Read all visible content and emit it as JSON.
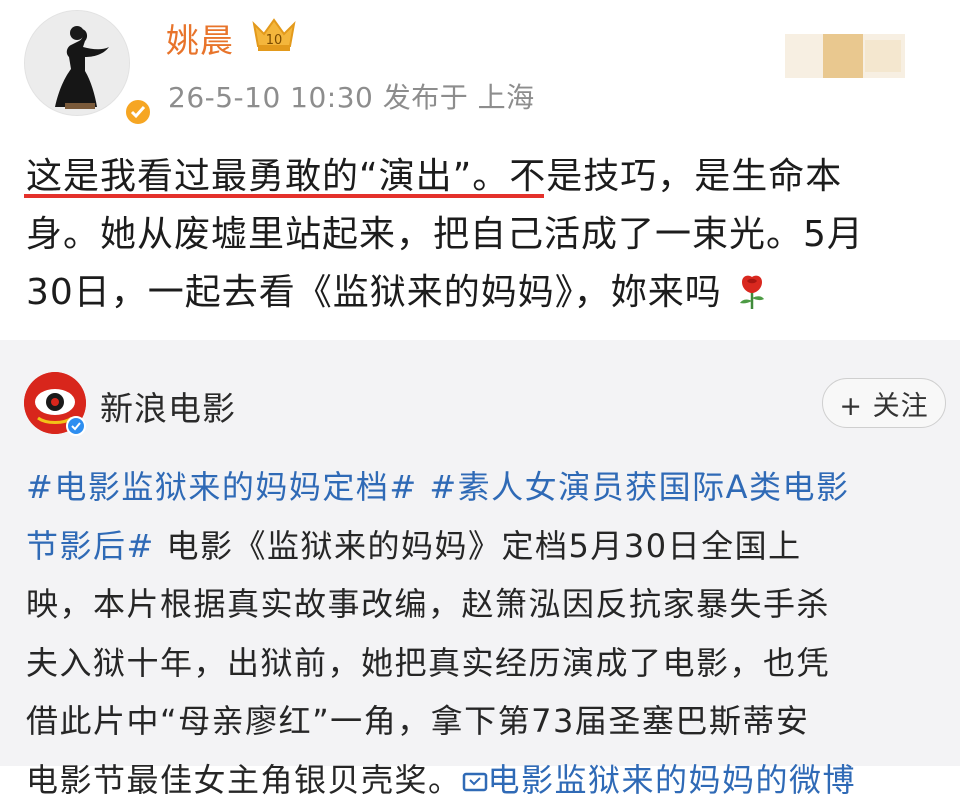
{
  "post": {
    "author": "姚晨",
    "vip_badge": "10",
    "meta": "26-5-10 10:30  发布于 上海",
    "text_line1": "这是我看过最勇敢的“演出”。不是技巧，是生命本",
    "text_line2": "身。她从废墟里站起来，把自己活成了一束光。5月",
    "text_line3": "30日，一起去看《监狱来的妈妈》，妳来吗",
    "colors": {
      "name": "#e8742b",
      "underline": "#e4312b"
    }
  },
  "repost": {
    "author": "新浪电影",
    "follow_label": "+ 关注",
    "hashtag1": "#电影监狱来的妈妈定档#",
    "hashtag2": "#素人女演员获国际A类电影",
    "line2_hashtag_end": "节影后#",
    "line2_text": " 电影《监狱来的妈妈》定档5月30日全国上",
    "line3": "映，本片根据真实故事改编，赵箫泓因反抗家暴失手杀",
    "line4": "夫入狱十年，出狱前，她把真实经历演成了电影，也凭",
    "line5": "借此片中“母亲廖红”一角，拿下第73届圣塞巴斯蒂安",
    "line6_text": "电影节最佳女主角银贝壳奖。",
    "line6_link": "电影监狱来的妈妈的微博",
    "colors": {
      "hashtag": "#2f6ab6",
      "background": "#f3f3f5"
    }
  },
  "icons": [
    "verified-badge-icon",
    "vip-crown-icon",
    "rose-icon",
    "sina-film-logo-icon",
    "link-icon"
  ]
}
